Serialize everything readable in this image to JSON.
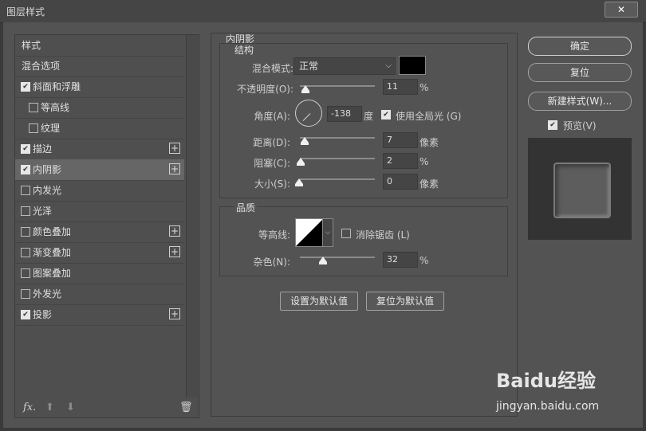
{
  "window": {
    "title": "图层样式",
    "close": "✕"
  },
  "left": {
    "header": "样式",
    "blend": "混合选项",
    "items": [
      {
        "label": "斜面和浮雕",
        "checked": true,
        "plus": false,
        "sub": false,
        "sel": false
      },
      {
        "label": "等高线",
        "checked": false,
        "plus": false,
        "sub": true,
        "sel": false
      },
      {
        "label": "纹理",
        "checked": false,
        "plus": false,
        "sub": true,
        "sel": false
      },
      {
        "label": "描边",
        "checked": true,
        "plus": true,
        "sub": false,
        "sel": false
      },
      {
        "label": "内阴影",
        "checked": true,
        "plus": true,
        "sub": false,
        "sel": true
      },
      {
        "label": "内发光",
        "checked": false,
        "plus": false,
        "sub": false,
        "sel": false
      },
      {
        "label": "光泽",
        "checked": false,
        "plus": false,
        "sub": false,
        "sel": false
      },
      {
        "label": "颜色叠加",
        "checked": false,
        "plus": true,
        "sub": false,
        "sel": false
      },
      {
        "label": "渐变叠加",
        "checked": false,
        "plus": true,
        "sub": false,
        "sel": false
      },
      {
        "label": "图案叠加",
        "checked": false,
        "plus": false,
        "sub": false,
        "sel": false
      },
      {
        "label": "外发光",
        "checked": false,
        "plus": false,
        "sub": false,
        "sel": false
      },
      {
        "label": "投影",
        "checked": true,
        "plus": true,
        "sub": false,
        "sel": false
      }
    ],
    "fx": "fx."
  },
  "inner": {
    "title": "内阴影",
    "structure": "结构",
    "blend_label": "混合模式:",
    "blend_value": "正常",
    "opacity_label": "不透明度(O):",
    "opacity": "11",
    "opacity_pct": 11,
    "pct": "%",
    "angle_label": "角度(A):",
    "angle": "-138",
    "angle_unit": "度",
    "global_label": "使用全局光 (G)",
    "distance_label": "距离(D):",
    "distance": "7",
    "choke_label": "阻塞(C):",
    "choke": "2",
    "size_label": "大小(S):",
    "size": "0",
    "px": "像素",
    "quality": "品质",
    "contour_label": "等高线:",
    "antialias_label": "消除锯齿 (L)",
    "noise_label": "杂色(N):",
    "noise": "32",
    "noise_pct": 32,
    "set_default": "设置为默认值",
    "reset_default": "复位为默认值"
  },
  "right": {
    "ok": "确定",
    "reset": "复位",
    "new_style": "新建样式(W)...",
    "preview": "预览(V)"
  },
  "watermark": {
    "brand": "Baidu经验",
    "url": "jingyan.baidu.com"
  },
  "colors": {
    "shadow_color": "#000000",
    "panel": "#535353"
  }
}
